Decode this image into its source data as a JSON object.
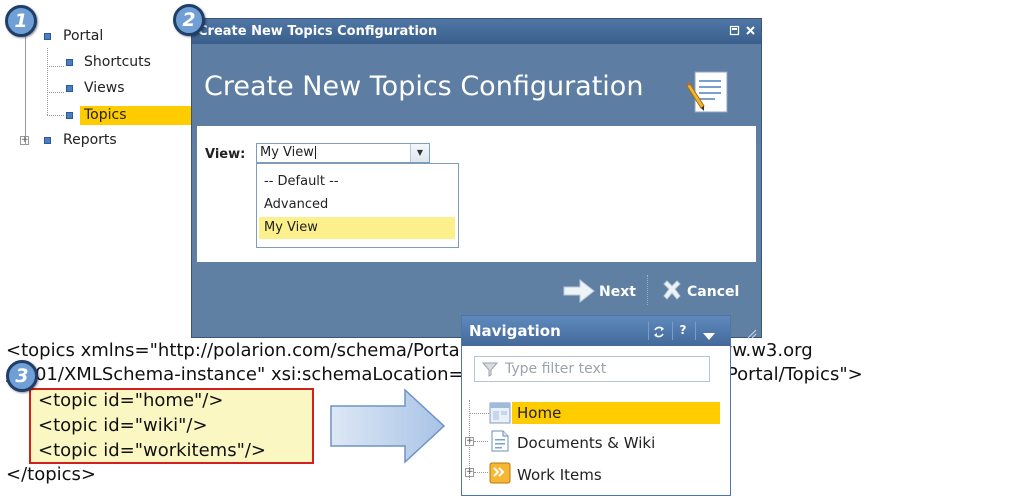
{
  "badges": [
    "1",
    "2",
    "3"
  ],
  "tree": {
    "items": [
      {
        "label": "Portal"
      },
      {
        "label": "Shortcuts"
      },
      {
        "label": "Views"
      },
      {
        "label": "Topics",
        "selected": true
      },
      {
        "label": "Reports"
      }
    ],
    "expand_symbol": "+",
    "selected_color": "#ffcc00"
  },
  "dialog": {
    "title": "Create New Topics Configuration",
    "heading": "Create New Topics Configuration",
    "view_label": "View:",
    "view_value": "My View",
    "options": [
      "-- Default --",
      "Advanced",
      "My View"
    ],
    "selected_option": "My View",
    "next_label": "Next",
    "cancel_label": "Cancel",
    "accent_color": "#5d7da2"
  },
  "code": {
    "line1": "<topics xmlns=\"http://polarion.com/schema/Portal/Topics\" xmlns:xsi=\"http://www.w3.org",
    "line2": "/2001/XMLSchema-instance\" xsi:schemaLocation=\"http://polarion.com/schema/Portal/Topics\">",
    "topics": [
      "<topic id=\"home\"/>",
      "<topic id=\"wiki\"/>",
      "<topic id=\"workitems\"/>"
    ],
    "closing": "</topics>",
    "highlight_border": "#d41f1f"
  },
  "navigation": {
    "title": "Navigation",
    "filter_placeholder": "Type filter text",
    "items": [
      {
        "label": "Home",
        "selected": true
      },
      {
        "label": "Documents & Wiki"
      },
      {
        "label": "Work Items"
      }
    ],
    "icons": [
      "refresh-icon",
      "help-icon",
      "menu-down-icon"
    ]
  }
}
